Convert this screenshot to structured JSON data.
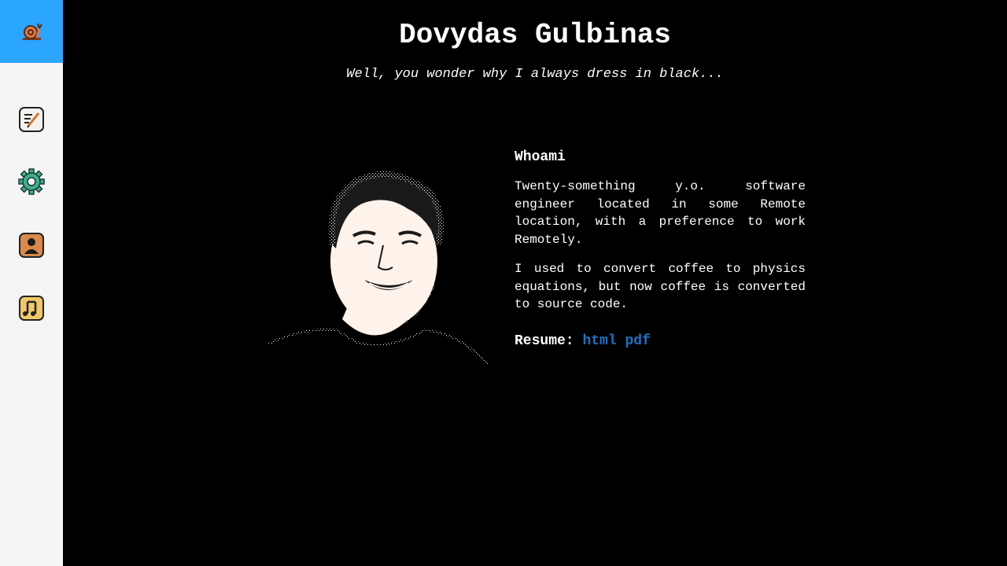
{
  "sidebar": {
    "home_icon": "snail-icon",
    "items": [
      {
        "name": "notes",
        "icon": "notepad-pencil-icon"
      },
      {
        "name": "settings",
        "icon": "gear-icon"
      },
      {
        "name": "profile",
        "icon": "person-icon"
      },
      {
        "name": "music",
        "icon": "music-notes-icon"
      }
    ],
    "colors": {
      "home_bg": "#2aa6ff",
      "sidebar_bg": "#f5f5f5"
    }
  },
  "header": {
    "title": "Dovydas Gulbinas",
    "tagline": "Well, you wonder why I always dress in black..."
  },
  "about": {
    "heading": "Whoami",
    "paragraphs": [
      "Twenty-something y.o. software engineer located in some Remote location, with a preference to work Remotely.",
      "I used to convert coffee to physics equations, but now coffee is converted to source code."
    ],
    "resume_label": "Resume:",
    "links": [
      {
        "label": "html"
      },
      {
        "label": "pdf"
      }
    ]
  },
  "colors": {
    "background": "#000000",
    "text": "#ffffff",
    "link": "#1a73c8"
  }
}
